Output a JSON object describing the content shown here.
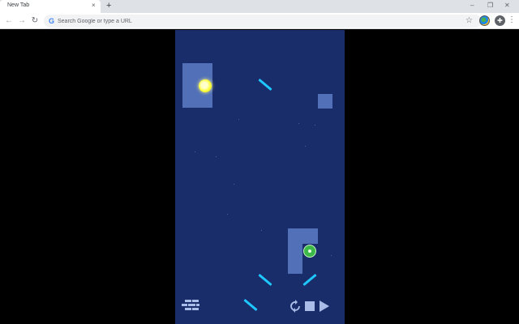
{
  "browser": {
    "tab_title": "New Tab",
    "tab_close": "×",
    "new_tab": "+",
    "win_minimize": "–",
    "win_restore": "❐",
    "win_close": "✕",
    "back": "←",
    "forward": "→",
    "reload": "↻",
    "omnibox_placeholder": "Search Google or type a URL",
    "google_logo": "G",
    "star": "☆",
    "extensions": "✚",
    "menu": "⋮"
  },
  "game": {
    "colors": {
      "board": "#1a2d6b",
      "block": "#5270b8",
      "mirror": "#1ec8ff",
      "emitter": "#ffff44",
      "receiver": "#3db94a",
      "controls": "#a9bde8"
    },
    "controls": [
      "bricks-menu-icon",
      "restart-icon",
      "stop-icon",
      "play-icon"
    ]
  }
}
